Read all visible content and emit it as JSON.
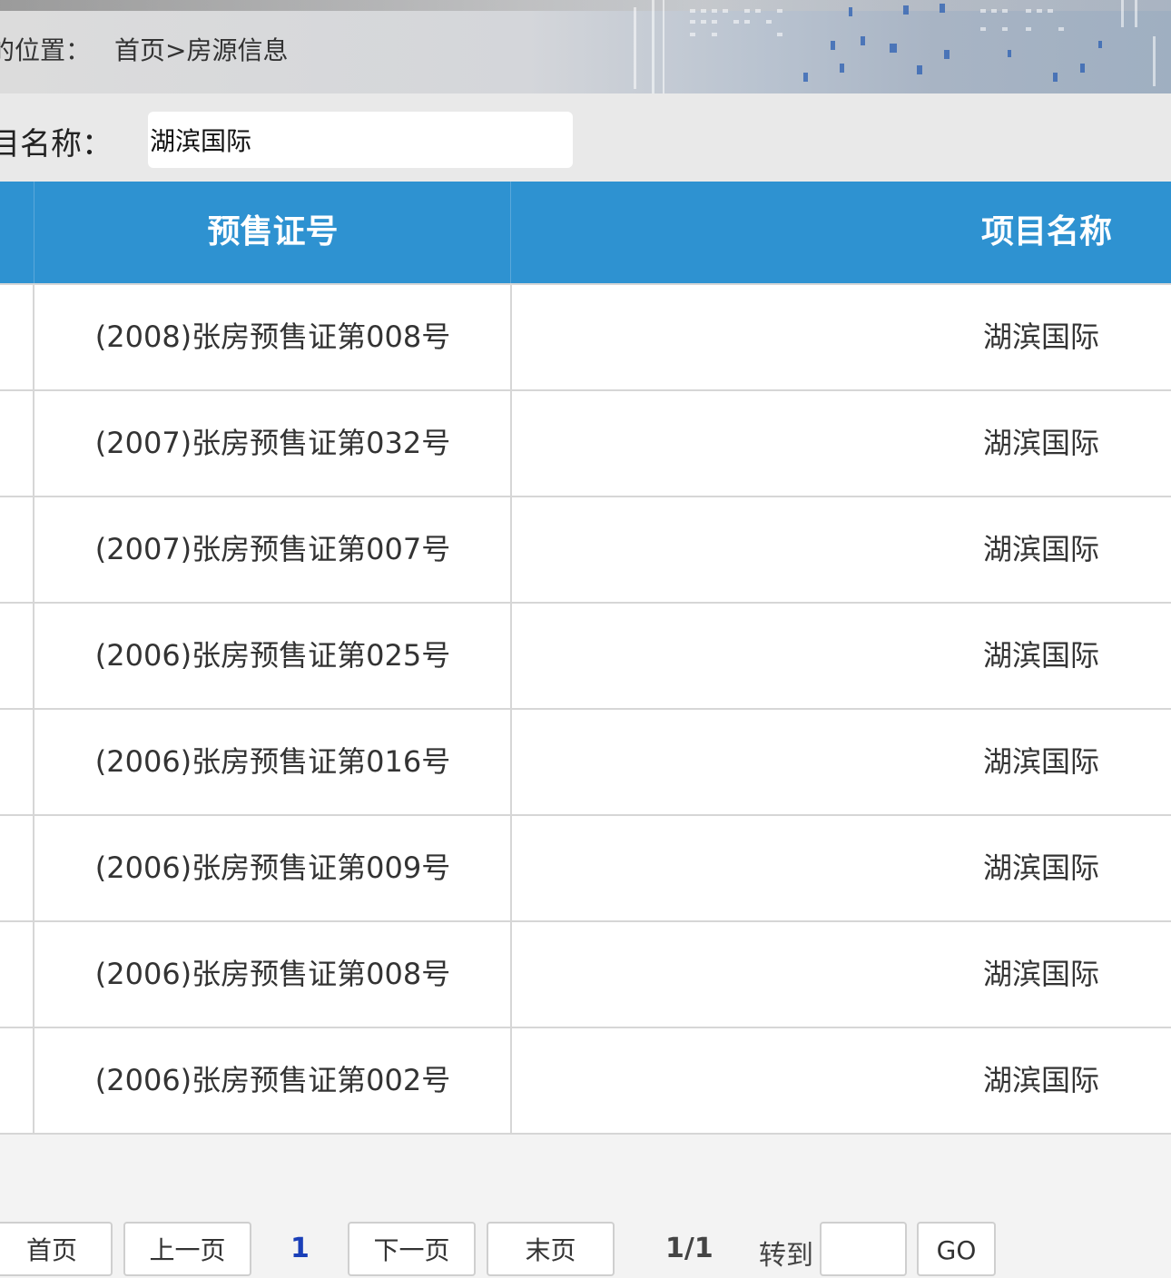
{
  "breadcrumb": {
    "prefix": "的位置：",
    "path": "首页>房源信息"
  },
  "search": {
    "label": "目名称：",
    "value": "湖滨国际"
  },
  "table": {
    "headers": [
      "预售证号",
      "项目名称"
    ],
    "rows": [
      {
        "cert": "(2008)张房预售证第008号",
        "name": "湖滨国际"
      },
      {
        "cert": "(2007)张房预售证第032号",
        "name": "湖滨国际"
      },
      {
        "cert": "(2007)张房预售证第007号",
        "name": "湖滨国际"
      },
      {
        "cert": "(2006)张房预售证第025号",
        "name": "湖滨国际"
      },
      {
        "cert": "(2006)张房预售证第016号",
        "name": "湖滨国际"
      },
      {
        "cert": "(2006)张房预售证第009号",
        "name": "湖滨国际"
      },
      {
        "cert": "(2006)张房预售证第008号",
        "name": "湖滨国际"
      },
      {
        "cert": "(2006)张房预售证第002号",
        "name": "湖滨国际"
      }
    ]
  },
  "pager": {
    "first": "首页",
    "prev": "上一页",
    "current": "1",
    "next": "下一页",
    "last": "末页",
    "summary": "1/1",
    "goto_label": "转到",
    "go": "GO"
  },
  "colors": {
    "header_bg": "#2e92d1",
    "current_page": "#1a3fb8"
  }
}
